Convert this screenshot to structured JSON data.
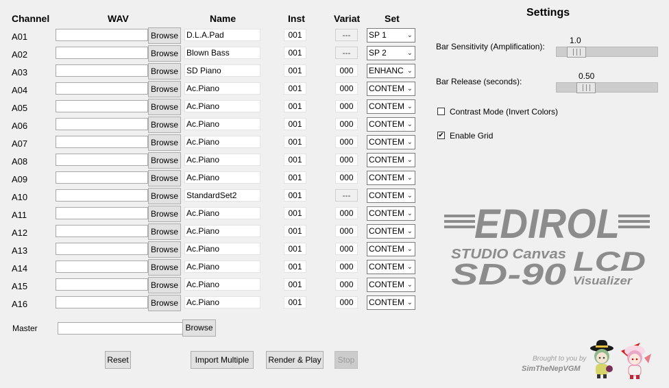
{
  "headers": {
    "channel": "Channel",
    "wav": "WAV",
    "name": "Name",
    "inst": "Inst",
    "variat": "Variat",
    "set": "Set"
  },
  "browse_label": "Browse",
  "rows": [
    {
      "channel": "A01",
      "name": "D.L.A.Pad",
      "inst": "001",
      "variat": "---",
      "set": "SP 1"
    },
    {
      "channel": "A02",
      "name": "Blown Bass",
      "inst": "001",
      "variat": "---",
      "set": "SP 2"
    },
    {
      "channel": "A03",
      "name": "SD Piano",
      "inst": "001",
      "variat": "000",
      "set": "ENHANC"
    },
    {
      "channel": "A04",
      "name": "Ac.Piano",
      "inst": "001",
      "variat": "000",
      "set": "CONTEM"
    },
    {
      "channel": "A05",
      "name": "Ac.Piano",
      "inst": "001",
      "variat": "000",
      "set": "CONTEM"
    },
    {
      "channel": "A06",
      "name": "Ac.Piano",
      "inst": "001",
      "variat": "000",
      "set": "CONTEM"
    },
    {
      "channel": "A07",
      "name": "Ac.Piano",
      "inst": "001",
      "variat": "000",
      "set": "CONTEM"
    },
    {
      "channel": "A08",
      "name": "Ac.Piano",
      "inst": "001",
      "variat": "000",
      "set": "CONTEM"
    },
    {
      "channel": "A09",
      "name": "Ac.Piano",
      "inst": "001",
      "variat": "000",
      "set": "CONTEM"
    },
    {
      "channel": "A10",
      "name": "StandardSet2",
      "inst": "001",
      "variat": "---",
      "set": "CONTEM"
    },
    {
      "channel": "A11",
      "name": "Ac.Piano",
      "inst": "001",
      "variat": "000",
      "set": "CONTEM"
    },
    {
      "channel": "A12",
      "name": "Ac.Piano",
      "inst": "001",
      "variat": "000",
      "set": "CONTEM"
    },
    {
      "channel": "A13",
      "name": "Ac.Piano",
      "inst": "001",
      "variat": "000",
      "set": "CONTEM"
    },
    {
      "channel": "A14",
      "name": "Ac.Piano",
      "inst": "001",
      "variat": "000",
      "set": "CONTEM"
    },
    {
      "channel": "A15",
      "name": "Ac.Piano",
      "inst": "001",
      "variat": "000",
      "set": "CONTEM"
    },
    {
      "channel": "A16",
      "name": "Ac.Piano",
      "inst": "001",
      "variat": "000",
      "set": "CONTEM"
    }
  ],
  "master": {
    "label": "Master",
    "browse": "Browse"
  },
  "buttons": {
    "reset": "Reset",
    "import": "Import Multiple",
    "render": "Render & Play",
    "stop": "Stop"
  },
  "settings": {
    "title": "Settings",
    "sensitivity": {
      "label": "Bar Sensitivity (Amplification):",
      "value": "1.0",
      "fraction": 0.12
    },
    "release": {
      "label": "Bar Release (seconds):",
      "value": "0.50",
      "fraction": 0.24
    },
    "contrast": {
      "label": "Contrast Mode (Invert Colors)",
      "checked": false
    },
    "grid": {
      "label": "Enable Grid",
      "checked": true
    }
  },
  "logo": {
    "brand": "EDIROL",
    "product1": "STUDIO Canvas",
    "product2": "SD-90",
    "lcd": "LCD",
    "visualizer": "Visualizer",
    "color": "#8c8c8c"
  },
  "credit": {
    "line1": "Brought to you by",
    "line2": "SimTheNepVGM"
  }
}
